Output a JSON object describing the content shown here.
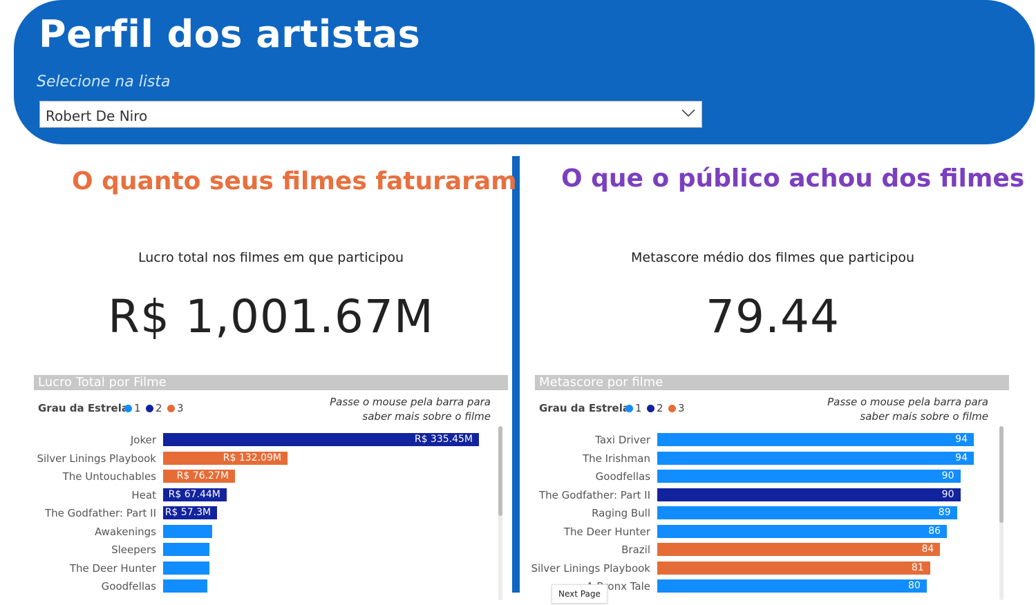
{
  "header": {
    "title": "Perfil dos artistas",
    "select_label": "Selecione na lista",
    "selected_artist": "Robert De Niro"
  },
  "left": {
    "title": "O quanto seus filmes faturaram",
    "kpi_label": "Lucro total nos filmes em que participou",
    "kpi_value": "R$ 1,001.67M",
    "chart_title": "Lucro Total por Filme",
    "legend_title": "Grau da Estrela",
    "hint_line1": "Passe o mouse pela barra para",
    "hint_line2": "saber mais sobre o filme"
  },
  "right": {
    "title": "O que o público achou dos filmes",
    "kpi_label": "Metascore médio dos filmes que participou",
    "kpi_value": "79.44",
    "chart_title": "Metascore por filme",
    "legend_title": "Grau da Estrela",
    "hint_line1": "Passe o mouse pela barra para",
    "hint_line2": "saber mais sobre o filme"
  },
  "legend": [
    {
      "label": "1",
      "color": "#118dff"
    },
    {
      "label": "2",
      "color": "#12239e"
    },
    {
      "label": "3",
      "color": "#e66c37"
    }
  ],
  "tooltip": "Next Page",
  "chart_data": [
    {
      "type": "bar",
      "title": "Lucro Total por Filme",
      "categories": [
        "Joker",
        "Silver Linings Playbook",
        "The Untouchables",
        "Heat",
        "The Godfather: Part II",
        "Awakenings",
        "Sleepers",
        "The Deer Hunter",
        "Goodfellas"
      ],
      "values": [
        335.45,
        132.09,
        76.27,
        67.44,
        57.3,
        52,
        49,
        49,
        47
      ],
      "labels": [
        "R$ 335.45M",
        "R$ 132.09M",
        "R$ 76.27M",
        "R$ 67.44M",
        "R$ 57.3M",
        "",
        "",
        "",
        ""
      ],
      "grau": [
        "2",
        "3",
        "3",
        "2",
        "2",
        "1",
        "1",
        "1",
        "1"
      ],
      "orientation": "horizontal"
    },
    {
      "type": "bar",
      "title": "Metascore por filme",
      "categories": [
        "Taxi Driver",
        "The Irishman",
        "Goodfellas",
        "The Godfather: Part II",
        "Raging Bull",
        "The Deer Hunter",
        "Brazil",
        "Silver Linings Playbook",
        "A Bronx Tale"
      ],
      "values": [
        94,
        94,
        90,
        90,
        89,
        86,
        84,
        81,
        80
      ],
      "labels": [
        "94",
        "94",
        "90",
        "90",
        "89",
        "86",
        "84",
        "81",
        "80"
      ],
      "grau": [
        "1",
        "1",
        "1",
        "2",
        "1",
        "1",
        "3",
        "3",
        "1"
      ],
      "orientation": "horizontal"
    }
  ]
}
